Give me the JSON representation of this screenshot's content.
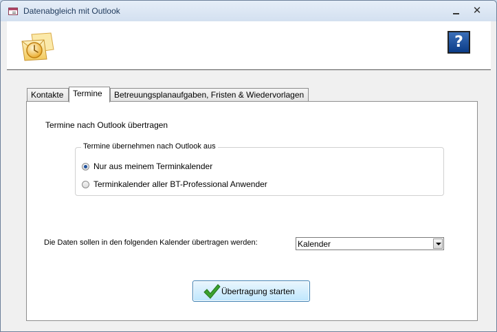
{
  "window": {
    "title": "Datenabgleich mit Outlook",
    "minimize_symbol": "_",
    "close_symbol": "✕"
  },
  "header": {
    "logo_icon": "outlook-envelope-icon",
    "help_label": "?"
  },
  "tabs": [
    {
      "label": "Kontakte",
      "active": false
    },
    {
      "label": "Termine",
      "active": true
    },
    {
      "label": "Betreuungsplanaufgaben, Fristen & Wiedervorlagen",
      "active": false
    }
  ],
  "termine": {
    "heading": "Termine nach Outlook übertragen",
    "group_label": "Termine übernehmen nach Outlook aus",
    "options": [
      {
        "label": "Nur aus meinem Terminkalender",
        "checked": true
      },
      {
        "label": "Terminkalender aller BT-Professional Anwender",
        "checked": false
      }
    ],
    "calendar_label": "Die Daten sollen in den folgenden Kalender übertragen werden:",
    "calendar_value": "Kalender",
    "start_button_label": "Übertragung starten"
  },
  "colors": {
    "accent": "#3c7fb1",
    "check_green": "#3aa12e",
    "help_blue": "#0b3c88"
  }
}
